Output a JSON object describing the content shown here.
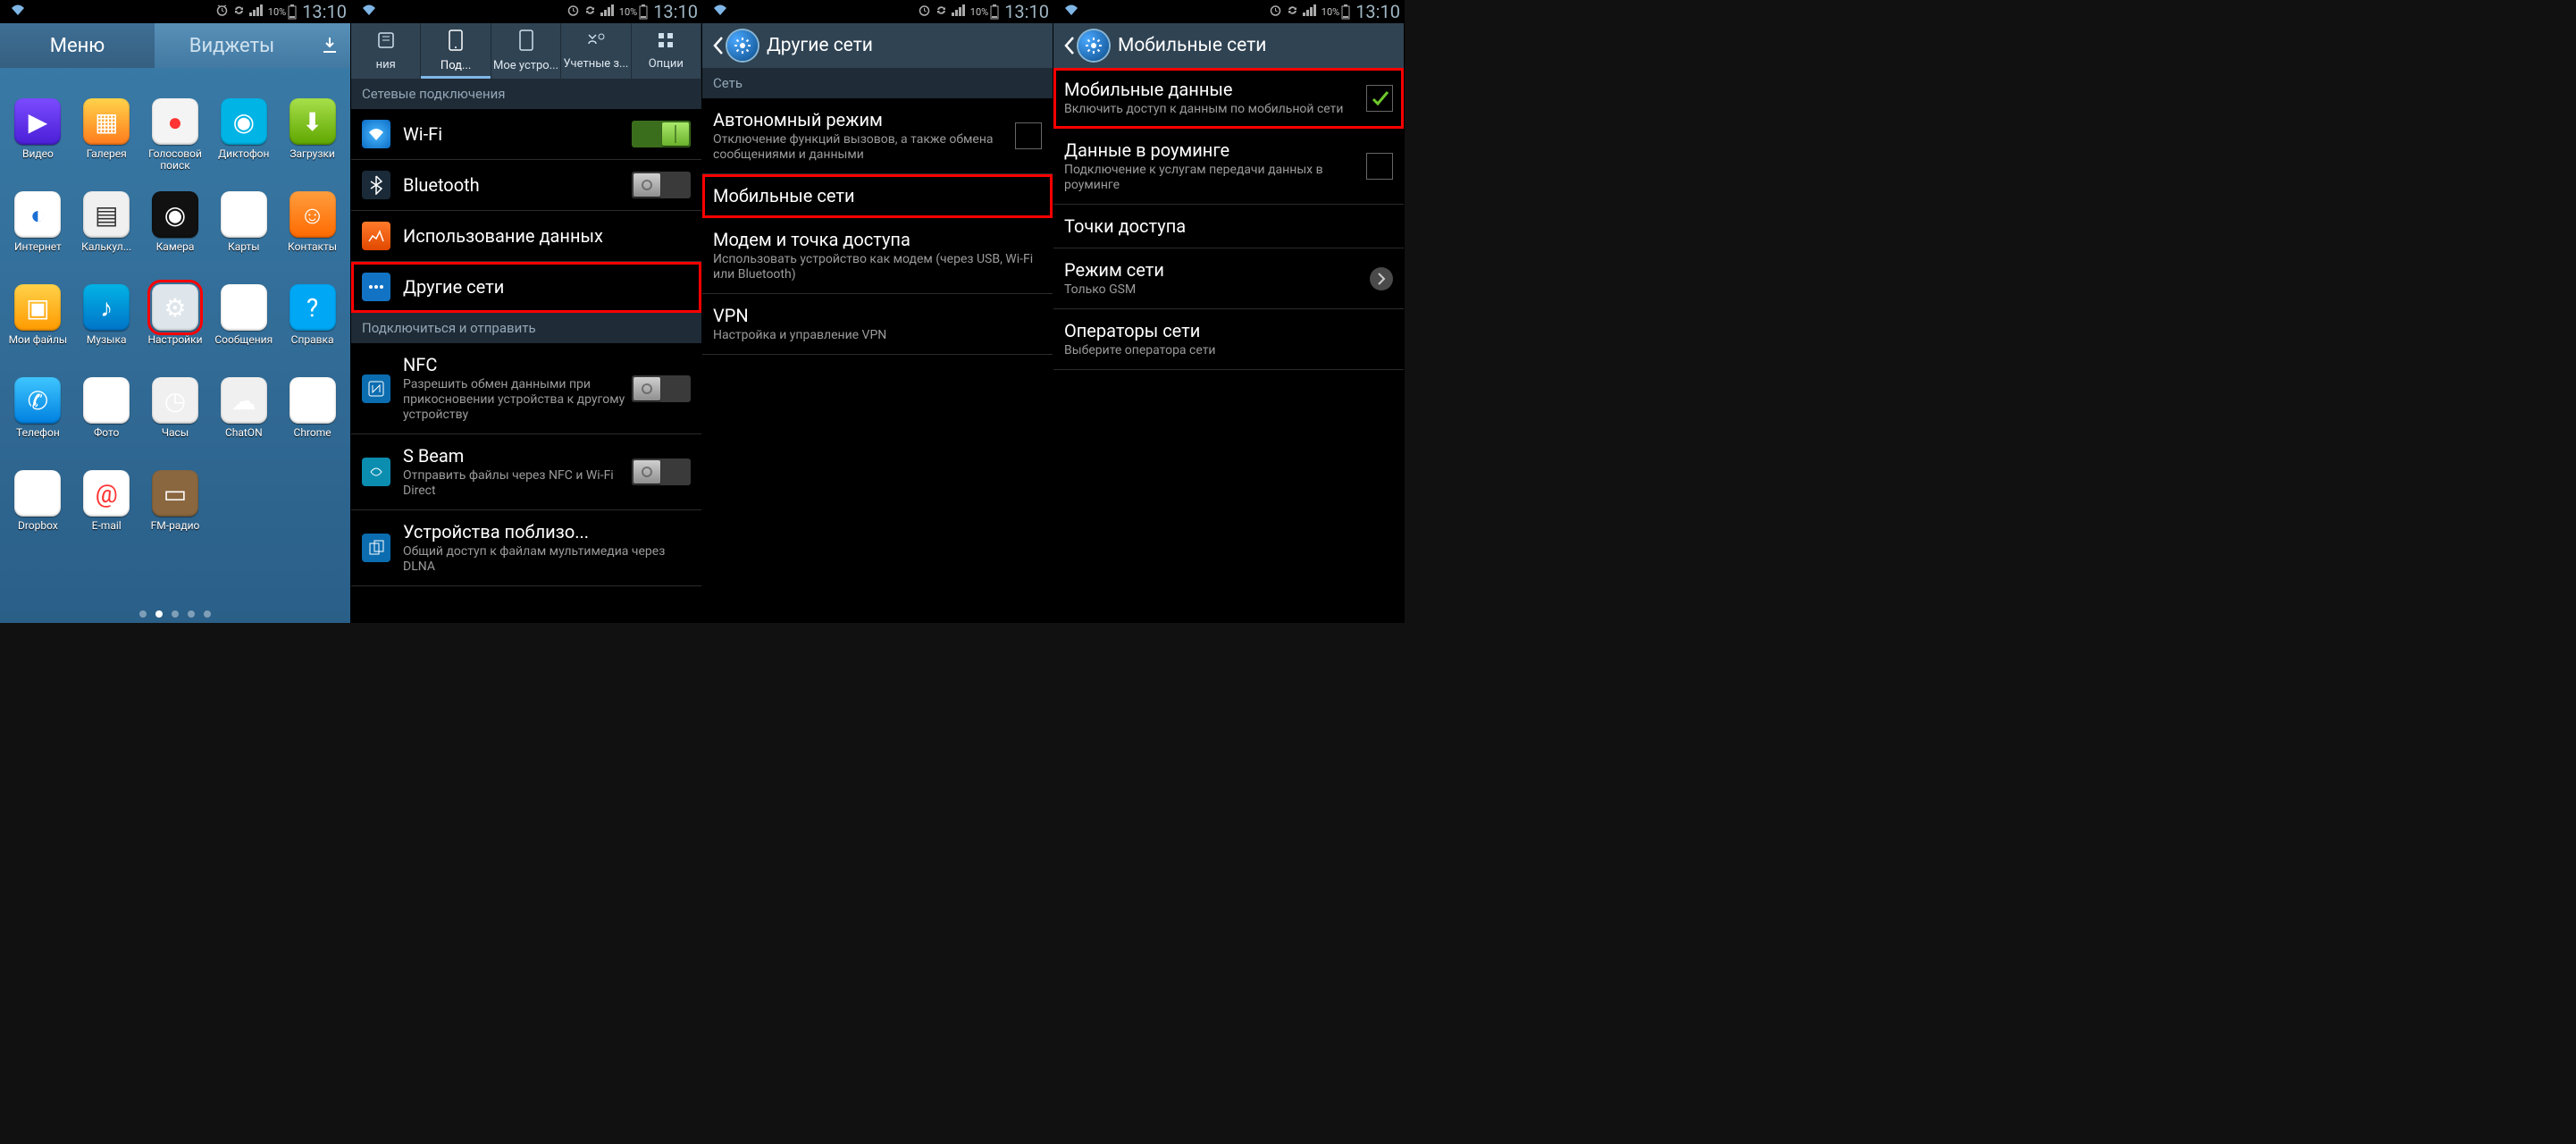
{
  "status": {
    "battery": "10%",
    "time": "13:10"
  },
  "screen1": {
    "tab_apps": "Меню",
    "tab_widgets": "Виджеты",
    "apps": [
      {
        "k": "video",
        "l": "Видео"
      },
      {
        "k": "gallery",
        "l": "Галерея"
      },
      {
        "k": "voice",
        "l": "Голосовой поиск"
      },
      {
        "k": "dict",
        "l": "Диктофон"
      },
      {
        "k": "dl",
        "l": "Загрузки"
      },
      {
        "k": "internet",
        "l": "Интернет"
      },
      {
        "k": "calc",
        "l": "Калькул..."
      },
      {
        "k": "cam",
        "l": "Камера"
      },
      {
        "k": "maps",
        "l": "Карты"
      },
      {
        "k": "contacts",
        "l": "Контакты"
      },
      {
        "k": "files",
        "l": "Мои файлы"
      },
      {
        "k": "music",
        "l": "Музыка"
      },
      {
        "k": "settings",
        "l": "Настройки",
        "hl": true
      },
      {
        "k": "msg",
        "l": "Сообщения"
      },
      {
        "k": "help",
        "l": "Справка"
      },
      {
        "k": "phoneapp",
        "l": "Телефон"
      },
      {
        "k": "photo",
        "l": "Фото"
      },
      {
        "k": "clock",
        "l": "Часы"
      },
      {
        "k": "chaton",
        "l": "ChatON"
      },
      {
        "k": "chrome",
        "l": "Chrome"
      },
      {
        "k": "dropbox",
        "l": "Dropbox"
      },
      {
        "k": "email",
        "l": "E-mail"
      },
      {
        "k": "fm",
        "l": "FM-радио"
      }
    ]
  },
  "screen2": {
    "tabs": [
      {
        "l": "ния"
      },
      {
        "l": "Под..."
      },
      {
        "l": "Мое устро..."
      },
      {
        "l": "Учетные з..."
      },
      {
        "l": "Опции"
      }
    ],
    "sec1": "Сетевые подключения",
    "wifi": "Wi-Fi",
    "bt": "Bluetooth",
    "data": "Использование данных",
    "more": "Другие сети",
    "sec2": "Подключиться и отправить",
    "nfc_t": "NFC",
    "nfc_s": "Разрешить обмен данными при прикосновении устройства к другому устройству",
    "sbeam_t": "S Beam",
    "sbeam_s": "Отправить файлы через NFC и Wi-Fi Direct",
    "nearby_t": "Устройства поблизо...",
    "nearby_s": "Общий доступ к файлам мультимедиа через DLNA"
  },
  "screen3": {
    "title": "Другие сети",
    "sec": "Сеть",
    "air_t": "Автономный режим",
    "air_s": "Отключение функций вызовов, а также обмена сообщениями и данными",
    "mob": "Мобильные сети",
    "teth_t": "Модем и точка доступа",
    "teth_s": "Использовать устройство как модем (через USB, Wi-Fi или Bluetooth)",
    "vpn_t": "VPN",
    "vpn_s": "Настройка и управление VPN"
  },
  "screen4": {
    "title": "Мобильные сети",
    "md_t": "Мобильные данные",
    "md_s": "Включить доступ к данным по мобильной сети",
    "roam_t": "Данные в роуминге",
    "roam_s": "Подключение к услугам передачи данных в роуминге",
    "apn": "Точки доступа",
    "mode_t": "Режим сети",
    "mode_s": "Только GSM",
    "ops_t": "Операторы сети",
    "ops_s": "Выберите оператора сети"
  }
}
